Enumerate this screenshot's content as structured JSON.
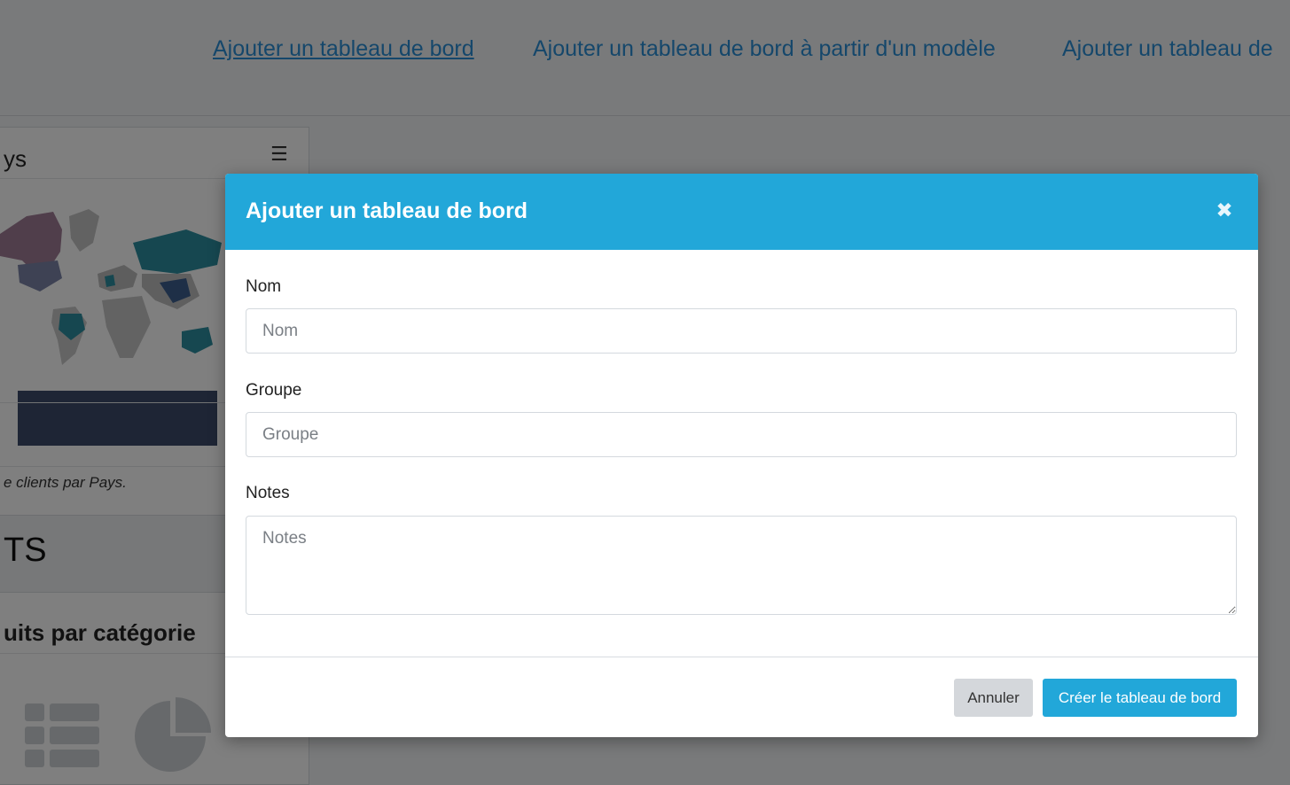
{
  "topnav": {
    "link_add_dashboard": "Ajouter un tableau de bord",
    "link_add_from_template": "Ajouter un tableau de bord à partir d'un modèle",
    "link_add_other": "Ajouter un tableau de"
  },
  "background_card": {
    "title": "ys",
    "menu_icon": "☰",
    "caption": "e clients par Pays.",
    "section_title": "TS",
    "subtitle": "uits par catégorie"
  },
  "modal": {
    "title": "Ajouter un tableau de bord",
    "close_icon": "✖",
    "fields": {
      "nom": {
        "label": "Nom",
        "placeholder": "Nom",
        "value": ""
      },
      "groupe": {
        "label": "Groupe",
        "placeholder": "Groupe",
        "value": ""
      },
      "notes": {
        "label": "Notes",
        "placeholder": "Notes",
        "value": ""
      }
    },
    "buttons": {
      "cancel": "Annuler",
      "create": "Créer le tableau de bord"
    }
  },
  "colors": {
    "primary": "#22a7d9",
    "link": "#2a8fd6",
    "cancel_bg": "#d4d7db",
    "map_bar": "#3c4a6a"
  }
}
